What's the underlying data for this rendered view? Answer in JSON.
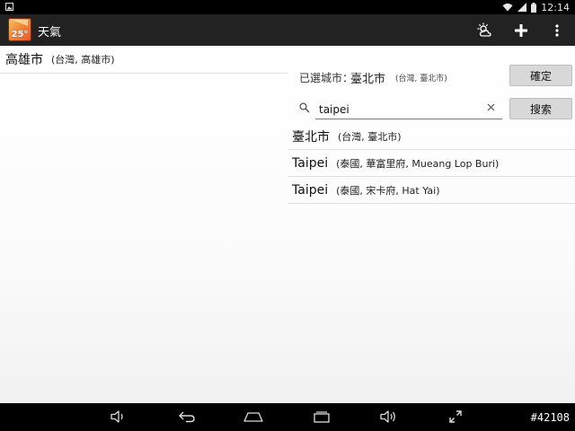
{
  "status_bar": {
    "time": "12:14",
    "icons": [
      "notification-icon",
      "wifi-icon",
      "signal-icon",
      "battery-icon"
    ]
  },
  "action_bar": {
    "app_icon_text": "25°",
    "title": "天氣",
    "actions": [
      "weather-refresh-icon",
      "add-icon",
      "overflow-menu-icon"
    ]
  },
  "left_pane": {
    "cities": [
      {
        "name": "高雄市",
        "region": "(台灣, 高雄市)"
      }
    ]
  },
  "right_pane": {
    "selected_label": "已選城市：",
    "selected_name": "臺北市",
    "selected_region": "(台灣, 臺北市)",
    "confirm_label": "確定",
    "search_value": "taipei",
    "search_label": "搜索",
    "results": [
      {
        "name": "臺北市",
        "region": "(台灣, 臺北市)"
      },
      {
        "name": "Taipei",
        "region": "(泰國, 華富里府, Mueang Lop Buri)"
      },
      {
        "name": "Taipei",
        "region": "(泰國, 宋卡府, Hat Yai)"
      }
    ]
  },
  "nav_bar": {
    "buttons": [
      "volume-down-icon",
      "back-icon",
      "home-icon",
      "recent-apps-icon",
      "volume-up-icon",
      "fullscreen-icon"
    ],
    "watermark": "#42108"
  },
  "colors": {
    "action_bar": "#222222",
    "button": "#d8d8d8",
    "background": "#ffffff"
  }
}
